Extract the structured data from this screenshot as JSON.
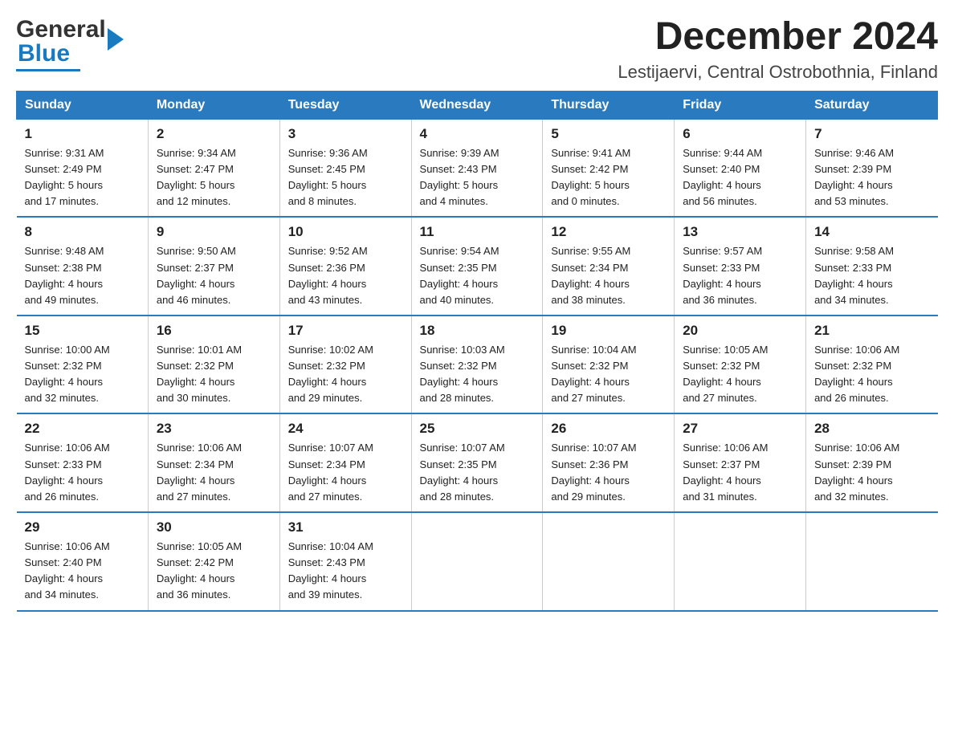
{
  "logo": {
    "brand_part1": "General",
    "brand_arrow": "▶",
    "brand_part2": "Blue"
  },
  "header": {
    "title": "December 2024",
    "subtitle": "Lestijaervi, Central Ostrobothnia, Finland"
  },
  "weekdays": [
    "Sunday",
    "Monday",
    "Tuesday",
    "Wednesday",
    "Thursday",
    "Friday",
    "Saturday"
  ],
  "weeks": [
    [
      {
        "day": "1",
        "sunrise": "Sunrise: 9:31 AM",
        "sunset": "Sunset: 2:49 PM",
        "daylight": "Daylight: 5 hours",
        "daylight2": "and 17 minutes."
      },
      {
        "day": "2",
        "sunrise": "Sunrise: 9:34 AM",
        "sunset": "Sunset: 2:47 PM",
        "daylight": "Daylight: 5 hours",
        "daylight2": "and 12 minutes."
      },
      {
        "day": "3",
        "sunrise": "Sunrise: 9:36 AM",
        "sunset": "Sunset: 2:45 PM",
        "daylight": "Daylight: 5 hours",
        "daylight2": "and 8 minutes."
      },
      {
        "day": "4",
        "sunrise": "Sunrise: 9:39 AM",
        "sunset": "Sunset: 2:43 PM",
        "daylight": "Daylight: 5 hours",
        "daylight2": "and 4 minutes."
      },
      {
        "day": "5",
        "sunrise": "Sunrise: 9:41 AM",
        "sunset": "Sunset: 2:42 PM",
        "daylight": "Daylight: 5 hours",
        "daylight2": "and 0 minutes."
      },
      {
        "day": "6",
        "sunrise": "Sunrise: 9:44 AM",
        "sunset": "Sunset: 2:40 PM",
        "daylight": "Daylight: 4 hours",
        "daylight2": "and 56 minutes."
      },
      {
        "day": "7",
        "sunrise": "Sunrise: 9:46 AM",
        "sunset": "Sunset: 2:39 PM",
        "daylight": "Daylight: 4 hours",
        "daylight2": "and 53 minutes."
      }
    ],
    [
      {
        "day": "8",
        "sunrise": "Sunrise: 9:48 AM",
        "sunset": "Sunset: 2:38 PM",
        "daylight": "Daylight: 4 hours",
        "daylight2": "and 49 minutes."
      },
      {
        "day": "9",
        "sunrise": "Sunrise: 9:50 AM",
        "sunset": "Sunset: 2:37 PM",
        "daylight": "Daylight: 4 hours",
        "daylight2": "and 46 minutes."
      },
      {
        "day": "10",
        "sunrise": "Sunrise: 9:52 AM",
        "sunset": "Sunset: 2:36 PM",
        "daylight": "Daylight: 4 hours",
        "daylight2": "and 43 minutes."
      },
      {
        "day": "11",
        "sunrise": "Sunrise: 9:54 AM",
        "sunset": "Sunset: 2:35 PM",
        "daylight": "Daylight: 4 hours",
        "daylight2": "and 40 minutes."
      },
      {
        "day": "12",
        "sunrise": "Sunrise: 9:55 AM",
        "sunset": "Sunset: 2:34 PM",
        "daylight": "Daylight: 4 hours",
        "daylight2": "and 38 minutes."
      },
      {
        "day": "13",
        "sunrise": "Sunrise: 9:57 AM",
        "sunset": "Sunset: 2:33 PM",
        "daylight": "Daylight: 4 hours",
        "daylight2": "and 36 minutes."
      },
      {
        "day": "14",
        "sunrise": "Sunrise: 9:58 AM",
        "sunset": "Sunset: 2:33 PM",
        "daylight": "Daylight: 4 hours",
        "daylight2": "and 34 minutes."
      }
    ],
    [
      {
        "day": "15",
        "sunrise": "Sunrise: 10:00 AM",
        "sunset": "Sunset: 2:32 PM",
        "daylight": "Daylight: 4 hours",
        "daylight2": "and 32 minutes."
      },
      {
        "day": "16",
        "sunrise": "Sunrise: 10:01 AM",
        "sunset": "Sunset: 2:32 PM",
        "daylight": "Daylight: 4 hours",
        "daylight2": "and 30 minutes."
      },
      {
        "day": "17",
        "sunrise": "Sunrise: 10:02 AM",
        "sunset": "Sunset: 2:32 PM",
        "daylight": "Daylight: 4 hours",
        "daylight2": "and 29 minutes."
      },
      {
        "day": "18",
        "sunrise": "Sunrise: 10:03 AM",
        "sunset": "Sunset: 2:32 PM",
        "daylight": "Daylight: 4 hours",
        "daylight2": "and 28 minutes."
      },
      {
        "day": "19",
        "sunrise": "Sunrise: 10:04 AM",
        "sunset": "Sunset: 2:32 PM",
        "daylight": "Daylight: 4 hours",
        "daylight2": "and 27 minutes."
      },
      {
        "day": "20",
        "sunrise": "Sunrise: 10:05 AM",
        "sunset": "Sunset: 2:32 PM",
        "daylight": "Daylight: 4 hours",
        "daylight2": "and 27 minutes."
      },
      {
        "day": "21",
        "sunrise": "Sunrise: 10:06 AM",
        "sunset": "Sunset: 2:32 PM",
        "daylight": "Daylight: 4 hours",
        "daylight2": "and 26 minutes."
      }
    ],
    [
      {
        "day": "22",
        "sunrise": "Sunrise: 10:06 AM",
        "sunset": "Sunset: 2:33 PM",
        "daylight": "Daylight: 4 hours",
        "daylight2": "and 26 minutes."
      },
      {
        "day": "23",
        "sunrise": "Sunrise: 10:06 AM",
        "sunset": "Sunset: 2:34 PM",
        "daylight": "Daylight: 4 hours",
        "daylight2": "and 27 minutes."
      },
      {
        "day": "24",
        "sunrise": "Sunrise: 10:07 AM",
        "sunset": "Sunset: 2:34 PM",
        "daylight": "Daylight: 4 hours",
        "daylight2": "and 27 minutes."
      },
      {
        "day": "25",
        "sunrise": "Sunrise: 10:07 AM",
        "sunset": "Sunset: 2:35 PM",
        "daylight": "Daylight: 4 hours",
        "daylight2": "and 28 minutes."
      },
      {
        "day": "26",
        "sunrise": "Sunrise: 10:07 AM",
        "sunset": "Sunset: 2:36 PM",
        "daylight": "Daylight: 4 hours",
        "daylight2": "and 29 minutes."
      },
      {
        "day": "27",
        "sunrise": "Sunrise: 10:06 AM",
        "sunset": "Sunset: 2:37 PM",
        "daylight": "Daylight: 4 hours",
        "daylight2": "and 31 minutes."
      },
      {
        "day": "28",
        "sunrise": "Sunrise: 10:06 AM",
        "sunset": "Sunset: 2:39 PM",
        "daylight": "Daylight: 4 hours",
        "daylight2": "and 32 minutes."
      }
    ],
    [
      {
        "day": "29",
        "sunrise": "Sunrise: 10:06 AM",
        "sunset": "Sunset: 2:40 PM",
        "daylight": "Daylight: 4 hours",
        "daylight2": "and 34 minutes."
      },
      {
        "day": "30",
        "sunrise": "Sunrise: 10:05 AM",
        "sunset": "Sunset: 2:42 PM",
        "daylight": "Daylight: 4 hours",
        "daylight2": "and 36 minutes."
      },
      {
        "day": "31",
        "sunrise": "Sunrise: 10:04 AM",
        "sunset": "Sunset: 2:43 PM",
        "daylight": "Daylight: 4 hours",
        "daylight2": "and 39 minutes."
      },
      {
        "day": "",
        "sunrise": "",
        "sunset": "",
        "daylight": "",
        "daylight2": ""
      },
      {
        "day": "",
        "sunrise": "",
        "sunset": "",
        "daylight": "",
        "daylight2": ""
      },
      {
        "day": "",
        "sunrise": "",
        "sunset": "",
        "daylight": "",
        "daylight2": ""
      },
      {
        "day": "",
        "sunrise": "",
        "sunset": "",
        "daylight": "",
        "daylight2": ""
      }
    ]
  ]
}
